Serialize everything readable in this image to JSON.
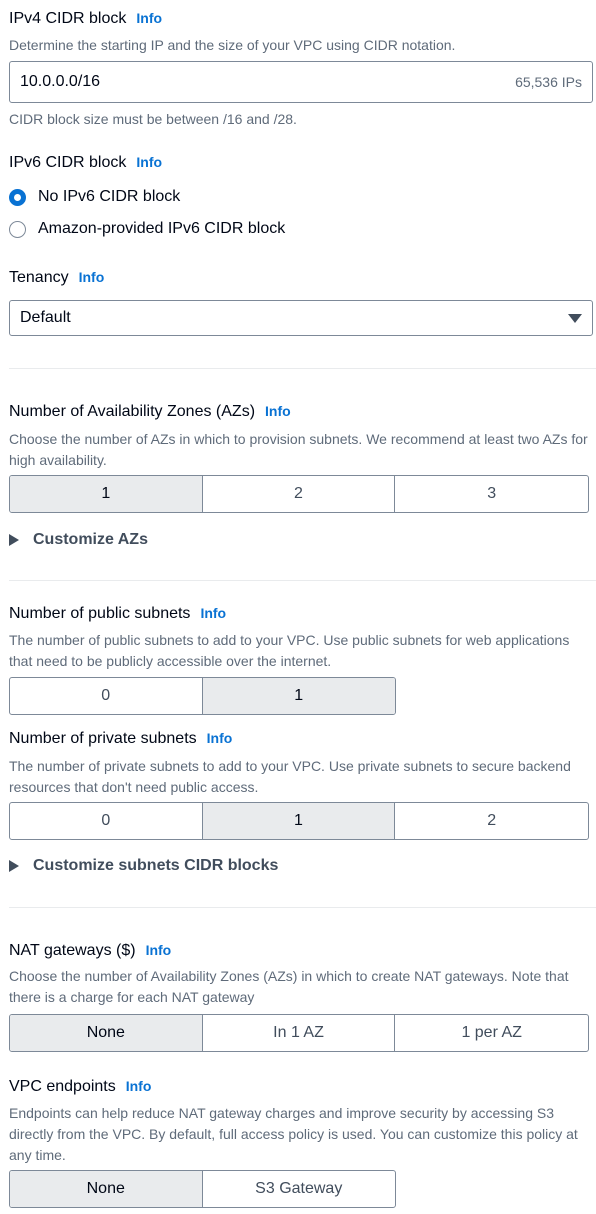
{
  "info": "Info",
  "ipv4": {
    "label": "IPv4 CIDR block",
    "desc": "Determine the starting IP and the size of your VPC using CIDR notation.",
    "value": "10.0.0.0/16",
    "suffix": "65,536 IPs",
    "hint": "CIDR block size must be between /16 and /28."
  },
  "ipv6": {
    "label": "IPv6 CIDR block",
    "options": [
      "No IPv6 CIDR block",
      "Amazon-provided IPv6 CIDR block"
    ],
    "selected": "No IPv6 CIDR block"
  },
  "tenancy": {
    "label": "Tenancy",
    "value": "Default"
  },
  "azs": {
    "label": "Number of Availability Zones (AZs)",
    "desc": "Choose the number of AZs in which to provision subnets. We recommend at least two AZs for high availability.",
    "options": [
      "1",
      "2",
      "3"
    ],
    "selected": "1",
    "expander": "Customize AZs"
  },
  "public": {
    "label": "Number of public subnets",
    "desc": "The number of public subnets to add to your VPC. Use public subnets for web applications that need to be publicly accessible over the internet.",
    "options": [
      "0",
      "1"
    ],
    "selected": "1"
  },
  "private": {
    "label": "Number of private subnets",
    "desc": "The number of private subnets to add to your VPC. Use private subnets to secure backend resources that don't need public access.",
    "options": [
      "0",
      "1",
      "2"
    ],
    "selected": "1",
    "expander": "Customize subnets CIDR blocks"
  },
  "nat": {
    "label": "NAT gateways ($)",
    "desc": "Choose the number of Availability Zones (AZs) in which to create NAT gateways. Note that there is a charge for each NAT gateway",
    "options": [
      "None",
      "In 1 AZ",
      "1 per AZ"
    ],
    "selected": "None"
  },
  "endpoints": {
    "label": "VPC endpoints",
    "desc": "Endpoints can help reduce NAT gateway charges and improve security by accessing S3 directly from the VPC. By default, full access policy is used. You can customize this policy at any time.",
    "options": [
      "None",
      "S3 Gateway"
    ],
    "selected": "None"
  },
  "colors": {
    "accent": "#0972d3",
    "selected_segment": "#e9ebed",
    "border": "#7d8998"
  }
}
